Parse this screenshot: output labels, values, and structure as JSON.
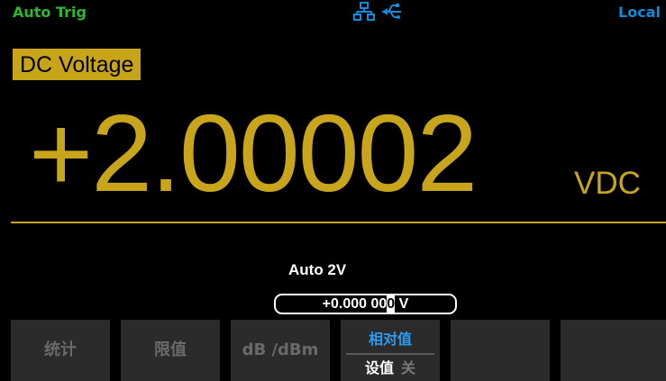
{
  "status": {
    "trigger": "Auto Trig",
    "mode": "Local",
    "icons": [
      "network-icon",
      "usb-icon"
    ],
    "colors": {
      "trigger": "#2fb82f",
      "mode": "#0a8de0"
    }
  },
  "measurement": {
    "function_label": "DC Voltage",
    "reading": "+2.00002",
    "unit": "VDC",
    "range": "Auto  2V",
    "setpoint_prefix": "+0.000 00",
    "setpoint_cursor": "0",
    "setpoint_suffix": " V",
    "colors": {
      "reading": "#c9a51c",
      "label_bg": "#c8a419"
    }
  },
  "softkeys": [
    {
      "label": "统计"
    },
    {
      "label": "限值"
    },
    {
      "label": "dB /dBm"
    },
    {
      "top": "相对值",
      "bottom": "设值",
      "bottom_state": "关"
    },
    {
      "label": ""
    },
    {
      "label": ""
    }
  ]
}
